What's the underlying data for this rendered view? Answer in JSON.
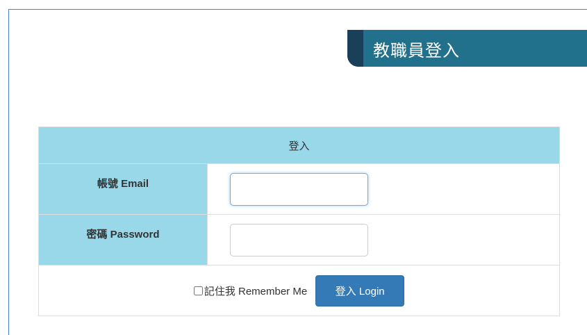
{
  "top_cut_text": "...",
  "banner": {
    "title": "教職員登入"
  },
  "form": {
    "header": "登入",
    "email_label": "帳號 Email",
    "email_value": "",
    "password_label": "密碼 Password",
    "password_value": "",
    "remember_label": "記住我 Remember Me",
    "remember_checked": false,
    "login_button": "登入 Login"
  },
  "colors": {
    "banner": "#21708c",
    "banner_stripe": "#1a3f58",
    "table_header": "#99d8e8",
    "button": "#337ab7"
  }
}
